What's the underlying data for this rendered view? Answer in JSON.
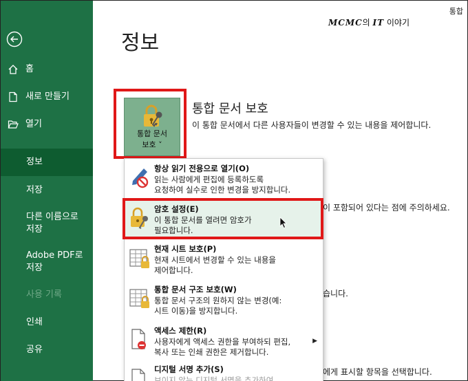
{
  "corner_label": "통합",
  "brand": {
    "bold": "MCMC",
    "mid": "의 ",
    "bold2": "IT",
    "rest": " 이야기"
  },
  "sidebar": {
    "items": [
      {
        "label": "홈",
        "icon": "home-icon"
      },
      {
        "label": "새로 만들기",
        "icon": "new-document-icon"
      },
      {
        "label": "열기",
        "icon": "open-folder-icon"
      },
      {
        "label": "정보",
        "selected": true
      },
      {
        "label": "저장"
      },
      {
        "label": "다른 이름으로",
        "label2": "저장"
      },
      {
        "label": "Adobe PDF로",
        "label2": "저장"
      },
      {
        "label": "사용 기록",
        "disabled": true
      },
      {
        "label": "인쇄"
      },
      {
        "label": "공유"
      }
    ]
  },
  "page_title": "정보",
  "protect": {
    "button_line1": "통합 문서",
    "button_line2": "보호 ˅",
    "title": "통합 문서 보호",
    "description": "이 통합 문서에서 다른 사용자들이 변경할 수 있는 내용을 제어합니다."
  },
  "background_fragments": {
    "line1": "이 포함되어 있다는 점에 주의하세요.",
    "line2": "습니다.",
    "line3": "에게 표시할 항목을 선택합니다."
  },
  "menu": {
    "items": [
      {
        "title": "항상 읽기 전용으로 열기(O)",
        "desc": [
          "읽는 사람에게 편집에 등록하도록",
          "요청하여 실수로 인한 변경을 방지합니다."
        ],
        "icon": "pencil-no-icon"
      },
      {
        "title": "암호 설정(E)",
        "desc": [
          "이 통합 문서를 열려면 암호가",
          "필요합니다."
        ],
        "icon": "lock-key-icon",
        "highlighted": true
      },
      {
        "title": "현재 시트 보호(P)",
        "desc": [
          "현재 시트에서 변경할 수 있는 내용을",
          "제어합니다."
        ],
        "icon": "sheet-lock-icon"
      },
      {
        "title": "통합 문서 구조 보호(W)",
        "desc": [
          "통합 문서 구조의 원하지 않는 변경(예:",
          "시트 이동)을 방지합니다."
        ],
        "icon": "workbook-structure-lock-icon"
      },
      {
        "title": "액세스 제한(R)",
        "desc": [
          "사용자에게 액세스 권한을 부여하되 편집,",
          "복사 또는 인쇄 권한은 제거합니다."
        ],
        "icon": "restrict-access-icon",
        "has_submenu": true
      },
      {
        "title": "디지털 서명 추가(S)",
        "desc": [
          "보이지 않는 디지털 서명을 추가하여"
        ],
        "icon": "signature-icon"
      }
    ]
  },
  "colors": {
    "sidebar": "#1e7145",
    "sidebar_selected": "#0e5c30",
    "highlight_box": "#e01818",
    "button": "#7db08e",
    "menu_hover": "#e6f2ea"
  }
}
